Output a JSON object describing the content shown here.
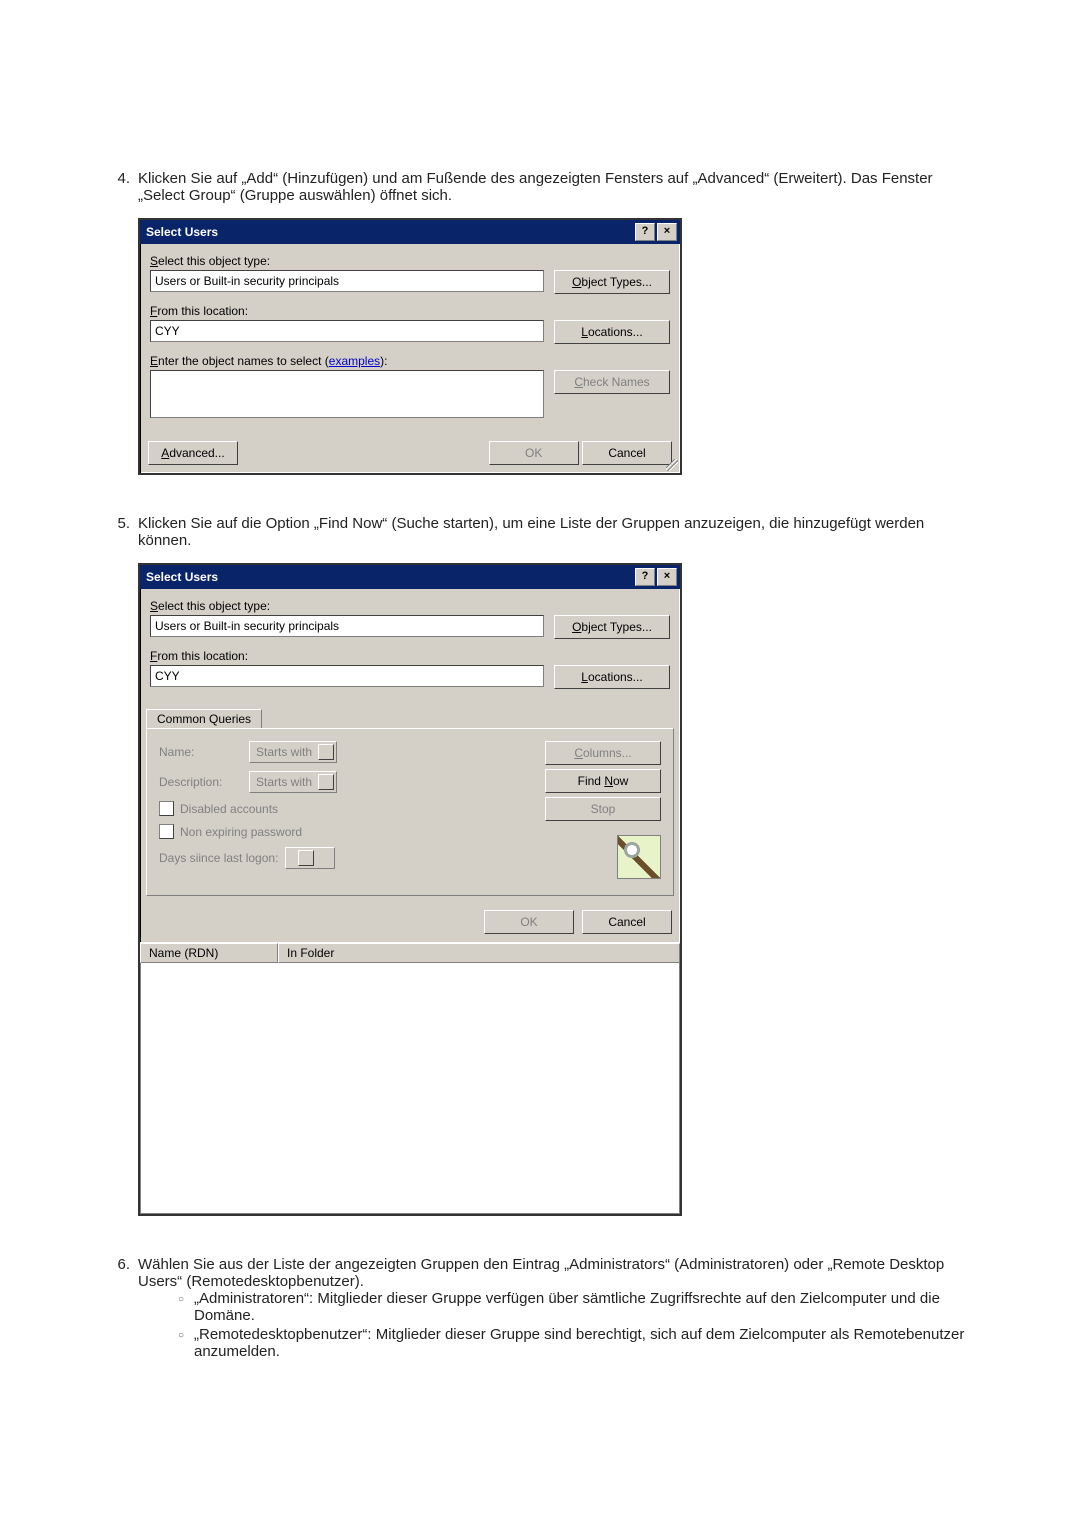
{
  "steps": {
    "s4": {
      "num": "4.",
      "text": "Klicken Sie auf „Add“ (Hinzufügen) und am Fußende des angezeigten Fensters auf „Advanced“ (Erweitert). Das Fenster „Select Group“ (Gruppe auswählen) öffnet sich."
    },
    "s5": {
      "num": "5.",
      "text": "Klicken Sie auf die Option „Find Now“ (Suche starten), um eine Liste der Gruppen anzuzeigen, die hinzugefügt werden können."
    },
    "s6": {
      "num": "6.",
      "text": "Wählen Sie aus der Liste der angezeigten Gruppen den Eintrag „Administrators“ (Administratoren) oder „Remote Desktop Users“ (Remotedesktopbenutzer).",
      "items": [
        "„Administratoren“: Mitglieder dieser Gruppe verfügen über sämtliche Zugriffsrechte auf den Zielcomputer und die Domäne.",
        "„Remotedesktopbenutzer“: Mitglieder dieser Gruppe sind berechtigt, sich auf dem Zielcomputer als Remotebenutzer anzumelden."
      ]
    }
  },
  "dlg1": {
    "title": "Select Users",
    "help": "?",
    "close": "×",
    "lbl_type_pre": "S",
    "lbl_type": "elect this object type:",
    "type_val": "Users or Built-in security principals",
    "btn_types_u": "O",
    "btn_types": "bject Types...",
    "lbl_from_pre": "F",
    "lbl_from": "rom this location:",
    "from_val": "CYY",
    "btn_loc_u": "L",
    "btn_loc": "ocations...",
    "lbl_names_pre": "E",
    "lbl_names": "nter the object names to select (",
    "lbl_names_link": "examples",
    "lbl_names_post": "):",
    "btn_check_pre": "C",
    "btn_check": "heck Names",
    "btn_adv_pre": "A",
    "btn_adv": "dvanced...",
    "btn_ok": "OK",
    "btn_cancel": "Cancel"
  },
  "dlg2": {
    "title": "Select Users",
    "help": "?",
    "close": "×",
    "lbl_type_pre": "S",
    "lbl_type": "elect this object type:",
    "type_val": "Users or Built-in security principals",
    "btn_types_u": "O",
    "btn_types": "bject Types...",
    "lbl_from_pre": "F",
    "lbl_from": "rom this location:",
    "from_val": "CYY",
    "btn_loc_u": "L",
    "btn_loc": "ocations...",
    "tab": "Common Queries",
    "q_name_lbl": "Name:",
    "q_name_dd": "Starts with",
    "q_desc_lbl_pre": "D",
    "q_desc_lbl": "escription:",
    "q_desc_dd": "Starts with",
    "q_disabled": "Disabled accounts",
    "q_nonexp": "Non expiring password",
    "q_days_pre": "Days s",
    "q_days": "ince last logon:",
    "btn_columns_pre": "C",
    "btn_columns": "olumns...",
    "btn_find_pre": "Find ",
    "btn_find_u": "N",
    "btn_find_post": "ow",
    "btn_stop": "Stop",
    "btn_ok": "OK",
    "btn_cancel": "Cancel",
    "res_h1": "Name (RDN)",
    "res_h2": "In Folder"
  }
}
